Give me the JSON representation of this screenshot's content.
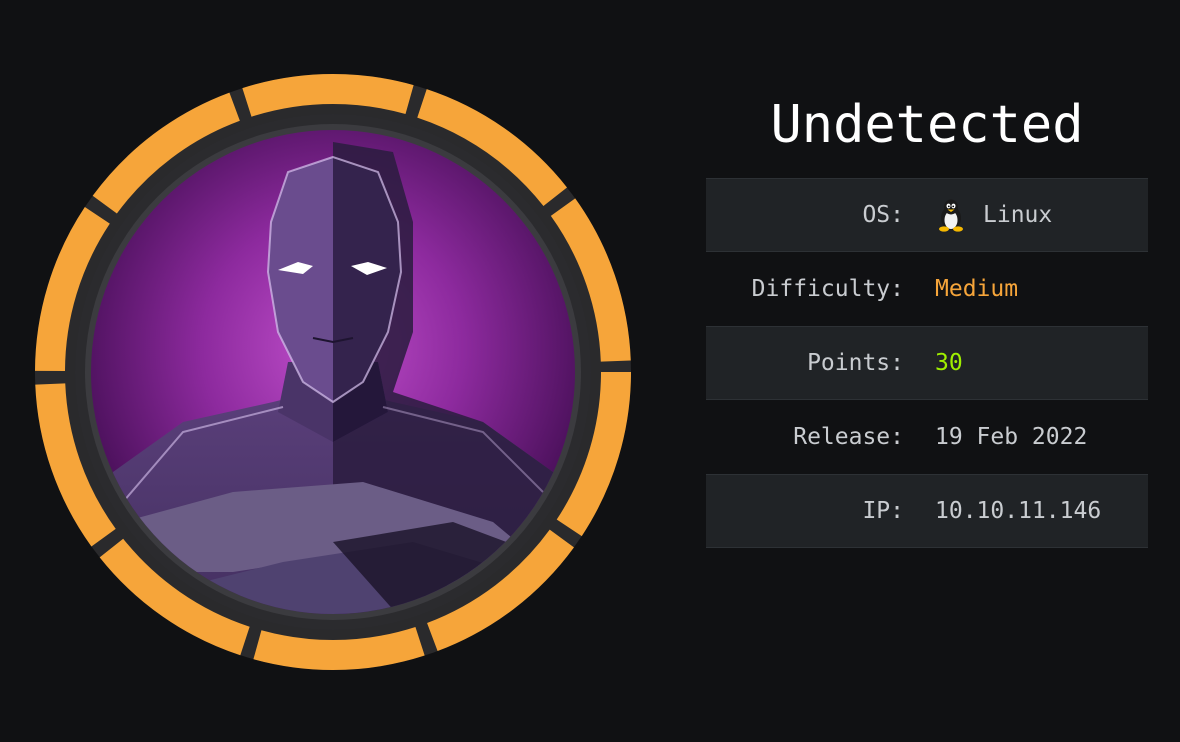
{
  "machine": {
    "name": "Undetected"
  },
  "info": {
    "os": {
      "label": "OS:",
      "value": "Linux",
      "icon": "linux-penguin-icon"
    },
    "difficulty": {
      "label": "Difficulty:",
      "value": "Medium"
    },
    "points": {
      "label": "Points:",
      "value": "30"
    },
    "release": {
      "label": "Release:",
      "value": "19 Feb 2022"
    },
    "ip": {
      "label": "IP:",
      "value": "10.10.11.146"
    }
  },
  "colors": {
    "background": "#101113",
    "row_shade": "#202326",
    "badge_ring": "#f6a53a",
    "difficulty": "#f6a53a",
    "points": "#9fef00",
    "avatar_purple": "#7a2a8f"
  },
  "badge": {
    "icon": "machine-avatar-image"
  }
}
